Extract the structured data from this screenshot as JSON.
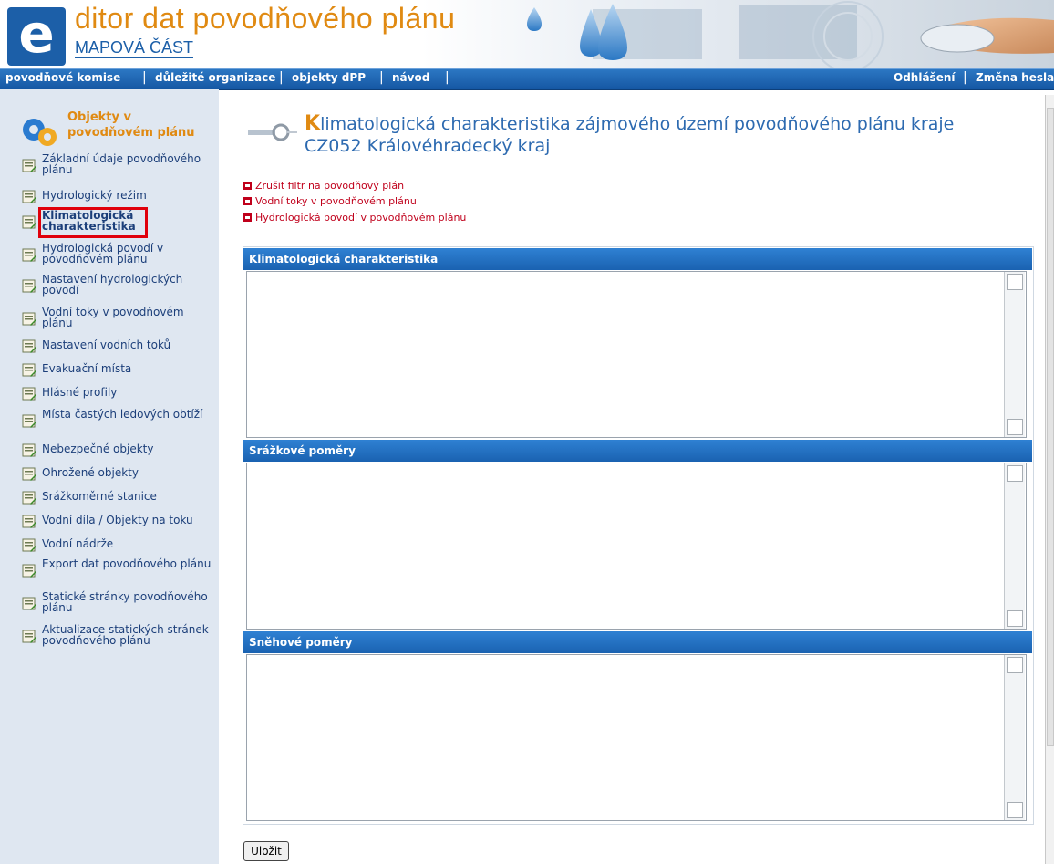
{
  "header": {
    "logo_letter": "e",
    "title": "ditor dat povodňového plánu",
    "subtitle": "MAPOVÁ ČÁST"
  },
  "nav": {
    "left": [
      "povodňové komise",
      "důležité organizace",
      "objekty dPP",
      "návod"
    ],
    "right": [
      "Odhlášení",
      "Změna hesla"
    ]
  },
  "sidebar": {
    "title_line1": "Objekty v",
    "title_line2": "povodňovém plánu",
    "items": [
      {
        "label": "Základní údaje povodňového plánu"
      },
      {
        "label": "Hydrologický režim"
      },
      {
        "label": "Klimatologická charakteristika",
        "active": true
      },
      {
        "label": "Hydrologická povodí v povodňovém plánu"
      },
      {
        "label": "Nastavení hydrologických povodí"
      },
      {
        "label": "Vodní toky v povodňovém plánu"
      },
      {
        "label": "Nastavení vodních toků"
      },
      {
        "label": "Evakuační místa"
      },
      {
        "label": "Hlásné profily"
      },
      {
        "label": "Místa častých ledových obtíží"
      },
      {
        "label": "Nebezpečné objekty"
      },
      {
        "label": "Ohrožené objekty"
      },
      {
        "label": "Srážkoměrné stanice"
      },
      {
        "label": "Vodní díla / Objekty na toku"
      },
      {
        "label": "Vodní nádrže"
      },
      {
        "label": "Export dat povodňového plánu"
      },
      {
        "label": "Statické stránky povodňového plánu"
      },
      {
        "label": "Aktualizace statických stránek povodňového plánu"
      }
    ]
  },
  "main": {
    "title_first_letter": "K",
    "title_rest": "limatologická charakteristika zájmového území povodňového plánu kraje CZ052 Královéhradecký kraj",
    "links": [
      "Zrušit filtr na povodňový plán",
      "Vodní toky v povodňovém plánu",
      "Hydrologická povodí v povodňovém plánu"
    ],
    "panels": [
      {
        "heading": "Klimatologická charakteristika",
        "value": ""
      },
      {
        "heading": "Srážkové poměry",
        "value": ""
      },
      {
        "heading": "Sněhové poměry",
        "value": ""
      }
    ],
    "save_label": "Uložit"
  },
  "colors": {
    "brand_blue": "#1c5fa8",
    "accent_orange": "#e08a12",
    "link_red": "#c0001b",
    "active_highlight": "#e0000b"
  }
}
